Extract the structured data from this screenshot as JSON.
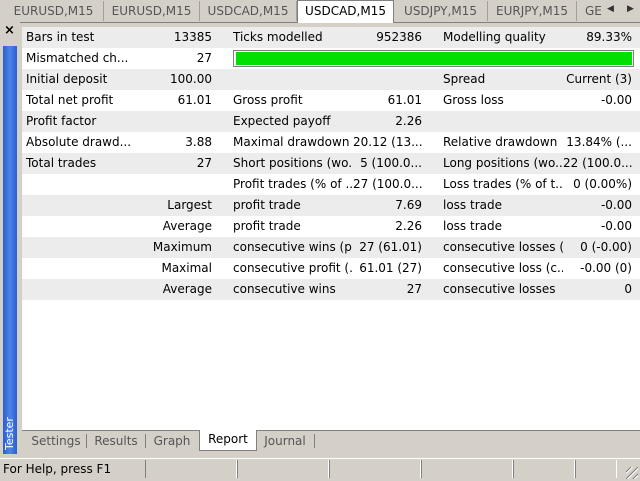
{
  "tabs": [
    {
      "label": "EURUSD,M15"
    },
    {
      "label": "EURUSD,M15"
    },
    {
      "label": "USDCAD,M15"
    },
    {
      "label": "USDCAD,M15",
      "active": true
    },
    {
      "label": "USDJPY,M15"
    },
    {
      "label": "EURJPY,M15"
    },
    {
      "label": "GE"
    }
  ],
  "tab_nav": {
    "left": "◀",
    "right": "▶"
  },
  "panel": {
    "close": "×",
    "label": "Tester"
  },
  "report": {
    "bars": {
      "label": "Bars in test",
      "value": "13385"
    },
    "ticks": {
      "label": "Ticks modelled",
      "value": "952386"
    },
    "quality": {
      "label": "Modelling quality",
      "value": "89.33%"
    },
    "mismatched": {
      "label": "Mismatched ch...",
      "value": "27"
    },
    "progress_fraction": 1.0,
    "deposit": {
      "label": "Initial deposit",
      "value": "100.00"
    },
    "spread": {
      "label": "Spread",
      "value": "Current (3)"
    },
    "net_profit": {
      "label": "Total net profit",
      "value": "61.01"
    },
    "gross_profit": {
      "label": "Gross profit",
      "value": "61.01"
    },
    "gross_loss": {
      "label": "Gross loss",
      "value": "-0.00"
    },
    "profit_factor": {
      "label": "Profit factor",
      "value": ""
    },
    "expected_payoff": {
      "label": "Expected payoff",
      "value": "2.26"
    },
    "abs_drawdown": {
      "label": "Absolute drawd...",
      "value": "3.88"
    },
    "max_drawdown": {
      "label": "Maximal drawdown",
      "value": "20.12 (13..."
    },
    "rel_drawdown": {
      "label": "Relative drawdown",
      "value": "13.84% (..."
    },
    "total_trades": {
      "label": "Total trades",
      "value": "27"
    },
    "short_pos": {
      "label": "Short positions (wo...",
      "value": "5 (100.0..."
    },
    "long_pos": {
      "label": "Long positions (wo...",
      "value": "22 (100.0..."
    },
    "profit_trades": {
      "label": "Profit trades (% of ...",
      "value": "27 (100.0..."
    },
    "loss_trades": {
      "label": "Loss trades (% of t...",
      "value": "0 (0.00%)"
    },
    "largest": {
      "label": "Largest",
      "p_label": "profit trade",
      "p_value": "7.69",
      "l_label": "loss trade",
      "l_value": "-0.00"
    },
    "average": {
      "label": "Average",
      "p_label": "profit trade",
      "p_value": "2.26",
      "l_label": "loss trade",
      "l_value": "-0.00"
    },
    "maximum": {
      "label": "Maximum",
      "p_label": "consecutive wins (p...",
      "p_value": "27 (61.01)",
      "l_label": "consecutive losses (...",
      "l_value": "0 (-0.00)"
    },
    "maximal": {
      "label": "Maximal",
      "p_label": "consecutive profit (...",
      "p_value": "61.01 (27)",
      "l_label": "consecutive loss (c...",
      "l_value": "-0.00 (0)"
    },
    "average2": {
      "label": "Average",
      "p_label": "consecutive wins",
      "p_value": "27",
      "l_label": "consecutive losses",
      "l_value": "0"
    }
  },
  "bottom_tabs": [
    "Settings",
    "Results",
    "Graph",
    "Report",
    "Journal"
  ],
  "status": {
    "text": "For Help, press F1"
  },
  "colors": {
    "progress": "#00e000",
    "panel_bar": "#2a5fd0"
  }
}
